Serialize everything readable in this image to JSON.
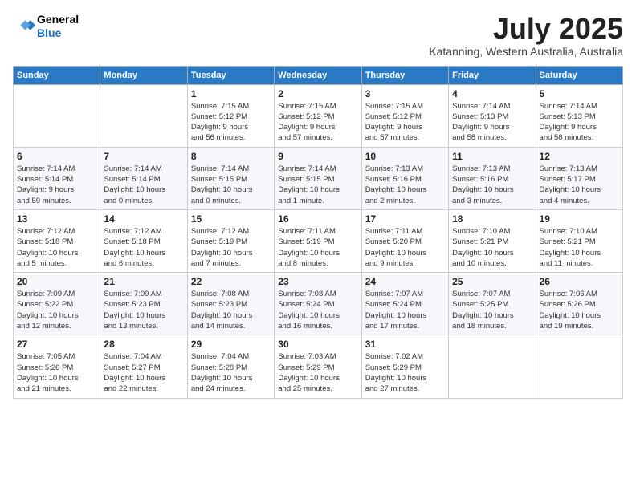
{
  "header": {
    "logo_line1": "General",
    "logo_line2": "Blue",
    "month": "July 2025",
    "location": "Katanning, Western Australia, Australia"
  },
  "calendar": {
    "headers": [
      "Sunday",
      "Monday",
      "Tuesday",
      "Wednesday",
      "Thursday",
      "Friday",
      "Saturday"
    ],
    "weeks": [
      [
        {
          "day": "",
          "info": ""
        },
        {
          "day": "",
          "info": ""
        },
        {
          "day": "1",
          "info": "Sunrise: 7:15 AM\nSunset: 5:12 PM\nDaylight: 9 hours\nand 56 minutes."
        },
        {
          "day": "2",
          "info": "Sunrise: 7:15 AM\nSunset: 5:12 PM\nDaylight: 9 hours\nand 57 minutes."
        },
        {
          "day": "3",
          "info": "Sunrise: 7:15 AM\nSunset: 5:12 PM\nDaylight: 9 hours\nand 57 minutes."
        },
        {
          "day": "4",
          "info": "Sunrise: 7:14 AM\nSunset: 5:13 PM\nDaylight: 9 hours\nand 58 minutes."
        },
        {
          "day": "5",
          "info": "Sunrise: 7:14 AM\nSunset: 5:13 PM\nDaylight: 9 hours\nand 58 minutes."
        }
      ],
      [
        {
          "day": "6",
          "info": "Sunrise: 7:14 AM\nSunset: 5:14 PM\nDaylight: 9 hours\nand 59 minutes."
        },
        {
          "day": "7",
          "info": "Sunrise: 7:14 AM\nSunset: 5:14 PM\nDaylight: 10 hours\nand 0 minutes."
        },
        {
          "day": "8",
          "info": "Sunrise: 7:14 AM\nSunset: 5:15 PM\nDaylight: 10 hours\nand 0 minutes."
        },
        {
          "day": "9",
          "info": "Sunrise: 7:14 AM\nSunset: 5:15 PM\nDaylight: 10 hours\nand 1 minute."
        },
        {
          "day": "10",
          "info": "Sunrise: 7:13 AM\nSunset: 5:16 PM\nDaylight: 10 hours\nand 2 minutes."
        },
        {
          "day": "11",
          "info": "Sunrise: 7:13 AM\nSunset: 5:16 PM\nDaylight: 10 hours\nand 3 minutes."
        },
        {
          "day": "12",
          "info": "Sunrise: 7:13 AM\nSunset: 5:17 PM\nDaylight: 10 hours\nand 4 minutes."
        }
      ],
      [
        {
          "day": "13",
          "info": "Sunrise: 7:12 AM\nSunset: 5:18 PM\nDaylight: 10 hours\nand 5 minutes."
        },
        {
          "day": "14",
          "info": "Sunrise: 7:12 AM\nSunset: 5:18 PM\nDaylight: 10 hours\nand 6 minutes."
        },
        {
          "day": "15",
          "info": "Sunrise: 7:12 AM\nSunset: 5:19 PM\nDaylight: 10 hours\nand 7 minutes."
        },
        {
          "day": "16",
          "info": "Sunrise: 7:11 AM\nSunset: 5:19 PM\nDaylight: 10 hours\nand 8 minutes."
        },
        {
          "day": "17",
          "info": "Sunrise: 7:11 AM\nSunset: 5:20 PM\nDaylight: 10 hours\nand 9 minutes."
        },
        {
          "day": "18",
          "info": "Sunrise: 7:10 AM\nSunset: 5:21 PM\nDaylight: 10 hours\nand 10 minutes."
        },
        {
          "day": "19",
          "info": "Sunrise: 7:10 AM\nSunset: 5:21 PM\nDaylight: 10 hours\nand 11 minutes."
        }
      ],
      [
        {
          "day": "20",
          "info": "Sunrise: 7:09 AM\nSunset: 5:22 PM\nDaylight: 10 hours\nand 12 minutes."
        },
        {
          "day": "21",
          "info": "Sunrise: 7:09 AM\nSunset: 5:23 PM\nDaylight: 10 hours\nand 13 minutes."
        },
        {
          "day": "22",
          "info": "Sunrise: 7:08 AM\nSunset: 5:23 PM\nDaylight: 10 hours\nand 14 minutes."
        },
        {
          "day": "23",
          "info": "Sunrise: 7:08 AM\nSunset: 5:24 PM\nDaylight: 10 hours\nand 16 minutes."
        },
        {
          "day": "24",
          "info": "Sunrise: 7:07 AM\nSunset: 5:24 PM\nDaylight: 10 hours\nand 17 minutes."
        },
        {
          "day": "25",
          "info": "Sunrise: 7:07 AM\nSunset: 5:25 PM\nDaylight: 10 hours\nand 18 minutes."
        },
        {
          "day": "26",
          "info": "Sunrise: 7:06 AM\nSunset: 5:26 PM\nDaylight: 10 hours\nand 19 minutes."
        }
      ],
      [
        {
          "day": "27",
          "info": "Sunrise: 7:05 AM\nSunset: 5:26 PM\nDaylight: 10 hours\nand 21 minutes."
        },
        {
          "day": "28",
          "info": "Sunrise: 7:04 AM\nSunset: 5:27 PM\nDaylight: 10 hours\nand 22 minutes."
        },
        {
          "day": "29",
          "info": "Sunrise: 7:04 AM\nSunset: 5:28 PM\nDaylight: 10 hours\nand 24 minutes."
        },
        {
          "day": "30",
          "info": "Sunrise: 7:03 AM\nSunset: 5:29 PM\nDaylight: 10 hours\nand 25 minutes."
        },
        {
          "day": "31",
          "info": "Sunrise: 7:02 AM\nSunset: 5:29 PM\nDaylight: 10 hours\nand 27 minutes."
        },
        {
          "day": "",
          "info": ""
        },
        {
          "day": "",
          "info": ""
        }
      ]
    ]
  }
}
